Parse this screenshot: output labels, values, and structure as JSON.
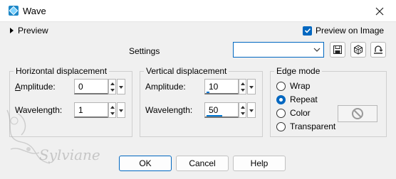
{
  "window": {
    "title": "Wave",
    "icon": "app-logo-icon",
    "close_icon": "close-icon"
  },
  "top": {
    "preview_label": "Preview",
    "preview_on_image_label": "Preview on Image",
    "preview_on_image_checked": true
  },
  "presets": {
    "settings_label": "Settings",
    "combo_value": "",
    "buttons": [
      "save-preset-icon",
      "random-dice-icon",
      "reset-icon"
    ]
  },
  "horizontal": {
    "title": "Horizontal displacement",
    "amplitude_label": "Amplitude:",
    "amplitude_value": "0",
    "wavelength_label": "Wavelength:",
    "wavelength_value": "1"
  },
  "vertical": {
    "title": "Vertical displacement",
    "amplitude_label": "Amplitude:",
    "amplitude_value": "10",
    "amplitude_fill_pct": 10,
    "wavelength_label": "Wavelength:",
    "wavelength_value": "50",
    "wavelength_fill_pct": 50
  },
  "edge": {
    "title": "Edge mode",
    "options": [
      "Wrap",
      "Repeat",
      "Color",
      "Transparent"
    ],
    "selected": "Repeat"
  },
  "footer": {
    "ok": "OK",
    "cancel": "Cancel",
    "help": "Help"
  },
  "watermark": {
    "text": "Sylviane"
  },
  "colors": {
    "accent": "#0067c0",
    "background": "#f0f0f0"
  }
}
